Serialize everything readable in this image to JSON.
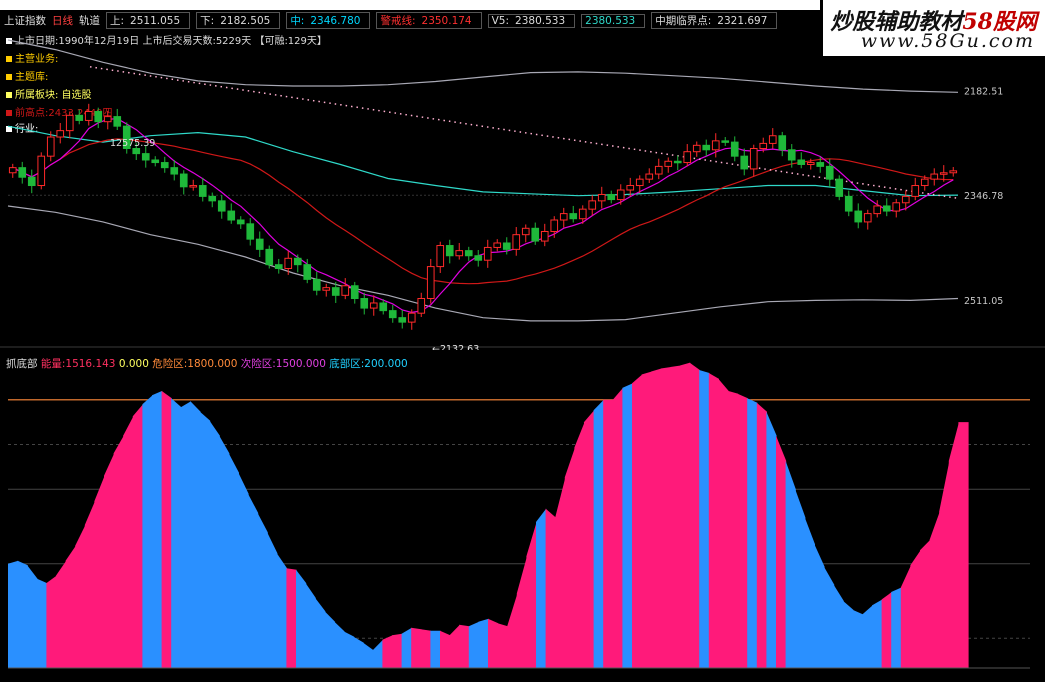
{
  "header": {
    "index_name": "上证指数",
    "period": "日线",
    "mode": "轨道",
    "up_label": "上:",
    "up_value": "2511.055",
    "down_label": "下:",
    "down_value": "2182.505",
    "mid_label": "中:",
    "mid_value": "2346.780",
    "mid_color": "#00d8ff",
    "risk_label": "警戒线:",
    "risk_value": "2350.174",
    "v5_label": "V5:",
    "v5_value": "2380.533",
    "v_extra_value": "2380.533",
    "critical_label": "中期临界点:",
    "critical_value": "2321.697"
  },
  "info": {
    "listing": "上市日期:1990年12月19日 上市后交易天数:5229天 【可融:129天】",
    "main_business": "主营业务:",
    "main_topic": "主题库:",
    "sector": "所属板块: 自选股",
    "high_point": "前高点:2433.2449四",
    "industry": "行业:"
  },
  "watermark": {
    "text_cn": "炒股辅助教材",
    "text_brand": "58股网",
    "url": "www.58Gu.com"
  },
  "price_chart": {
    "axis_labels": [
      "2511.05",
      "2346.78",
      "2182.51"
    ],
    "high_annotation": "12575.39",
    "low_annotation": "←2132.63",
    "colors": {
      "up": "#ff2a2a",
      "down": "#1fb83a",
      "upper_band": "#a8a8b4",
      "lower_band": "#a8a8b4",
      "mid_cyan": "#2fd9c9",
      "ma_red": "#d01818",
      "ma_magenta": "#e000e0",
      "dotted": "#ffb0d0"
    }
  },
  "indicator": {
    "title": "抓底部",
    "energy_label": "能量:",
    "energy_value": "1516.143",
    "zero_value": "0.000",
    "danger_label": "危险区:",
    "danger_value": "1800.000",
    "secondary_label": "次险区:",
    "secondary_value": "1500.000",
    "bottom_label": "底部区:",
    "bottom_value": "200.000",
    "colors": {
      "up": "#ff1a7a",
      "down": "#2a90ff",
      "danger": "#ff8a3a"
    }
  },
  "chart_data": [
    {
      "type": "candlestick",
      "title": "上证指数 日线",
      "ylim": [
        2120,
        2590
      ],
      "y_ticks": [
        2182.51,
        2346.78,
        2511.05
      ],
      "series": [
        {
          "name": "上",
          "values": [
            2590,
            2575,
            2555,
            2538,
            2526,
            2520,
            2518,
            2518,
            2520,
            2525,
            2532,
            2539,
            2540,
            2538,
            2534,
            2530,
            2524,
            2518,
            2513,
            2510,
            2508
          ]
        },
        {
          "name": "中",
          "values": [
            2455,
            2440,
            2430,
            2440,
            2445,
            2438,
            2415,
            2395,
            2373,
            2362,
            2352,
            2349,
            2346,
            2348,
            2352,
            2357,
            2362,
            2362,
            2354,
            2346,
            2347
          ]
        },
        {
          "name": "下",
          "values": [
            2330,
            2320,
            2305,
            2285,
            2270,
            2250,
            2225,
            2205,
            2190,
            2170,
            2155,
            2150,
            2150,
            2152,
            2162,
            2172,
            2180,
            2182,
            2183,
            2182,
            2185
          ]
        }
      ],
      "closes": [
        2390,
        2375,
        2362,
        2408,
        2438,
        2448,
        2472,
        2464,
        2478,
        2462,
        2470,
        2455,
        2420,
        2412,
        2402,
        2398,
        2390,
        2380,
        2360,
        2362,
        2345,
        2338,
        2322,
        2308,
        2302,
        2278,
        2262,
        2238,
        2232,
        2248,
        2238,
        2215,
        2198,
        2202,
        2190,
        2205,
        2185,
        2170,
        2178,
        2166,
        2155,
        2148,
        2162,
        2185,
        2235,
        2268,
        2252,
        2260,
        2252,
        2245,
        2265,
        2272,
        2262,
        2285,
        2295,
        2275,
        2290,
        2308,
        2318,
        2310,
        2325,
        2338,
        2348,
        2340,
        2355,
        2362,
        2372,
        2380,
        2392,
        2400,
        2398,
        2415,
        2425,
        2418,
        2432,
        2430,
        2408,
        2388,
        2420,
        2428,
        2440,
        2418,
        2402,
        2395,
        2398,
        2392,
        2372,
        2345,
        2322,
        2305,
        2318,
        2330,
        2322,
        2335,
        2345,
        2362,
        2372,
        2380,
        2382,
        2385
      ]
    },
    {
      "type": "area",
      "title": "抓底部",
      "ylim": [
        0,
        2000
      ],
      "reference_lines": [
        {
          "name": "危险区",
          "value": 1800
        },
        {
          "name": "次险区",
          "value": 1500
        },
        {
          "name": "底部区",
          "value": 200
        }
      ],
      "values": [
        700,
        720,
        690,
        600,
        570,
        620,
        720,
        820,
        960,
        1120,
        1290,
        1440,
        1560,
        1690,
        1770,
        1830,
        1860,
        1810,
        1750,
        1790,
        1720,
        1660,
        1560,
        1440,
        1310,
        1170,
        1040,
        910,
        770,
        670,
        660,
        570,
        470,
        380,
        310,
        245,
        210,
        170,
        120,
        190,
        220,
        230,
        270,
        260,
        250,
        250,
        220,
        290,
        280,
        310,
        330,
        300,
        280,
        500,
        750,
        980,
        1070,
        1010,
        1280,
        1480,
        1650,
        1730,
        1800,
        1800,
        1880,
        1910,
        1970,
        1990,
        2010,
        2020,
        2030,
        2050,
        2000,
        1980,
        1940,
        1860,
        1840,
        1810,
        1780,
        1720,
        1560,
        1390,
        1200,
        1010,
        830,
        680,
        560,
        450,
        390,
        360,
        420,
        460,
        510,
        540,
        690,
        790,
        860,
        1050,
        1390,
        1650
      ],
      "colors_pattern": "1=up (pink), 0=down (blue)",
      "up_flags": [
        0,
        0,
        0,
        0,
        1,
        1,
        1,
        1,
        1,
        1,
        1,
        1,
        1,
        1,
        0,
        0,
        1,
        0,
        0,
        0,
        0,
        0,
        0,
        0,
        0,
        0,
        0,
        0,
        0,
        1,
        0,
        0,
        0,
        0,
        0,
        0,
        0,
        0,
        0,
        1,
        1,
        0,
        1,
        1,
        0,
        1,
        1,
        1,
        0,
        0,
        1,
        1,
        1,
        1,
        1,
        0,
        1,
        1,
        1,
        1,
        1,
        0,
        1,
        1,
        0,
        1,
        1,
        1,
        1,
        1,
        1,
        1,
        0,
        1,
        1,
        1,
        1,
        0,
        1,
        0,
        1,
        0,
        0,
        0,
        0,
        0,
        0,
        0,
        0,
        0,
        0,
        1,
        0,
        1,
        1,
        1,
        1,
        1,
        1,
        1,
        1,
        1,
        1
      ]
    }
  ]
}
